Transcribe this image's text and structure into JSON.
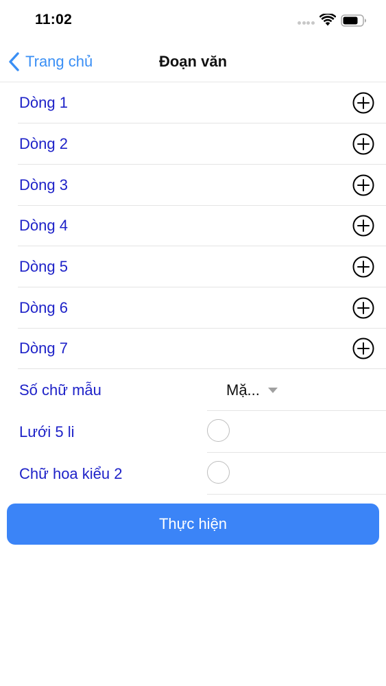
{
  "status_bar": {
    "time": "11:02"
  },
  "nav": {
    "back_label": "Trang chủ",
    "title": "Đoạn văn"
  },
  "lines": [
    {
      "label": "Dòng 1"
    },
    {
      "label": "Dòng 2"
    },
    {
      "label": "Dòng 3"
    },
    {
      "label": "Dòng 4"
    },
    {
      "label": "Dòng 5"
    },
    {
      "label": "Dòng 6"
    },
    {
      "label": "Dòng 7"
    }
  ],
  "options": {
    "sample_count": {
      "label": "Số chữ mẫu",
      "value": "Mặ..."
    },
    "grid_5li": {
      "label": "Lưới 5 li",
      "checked": false
    },
    "capital_style2": {
      "label": "Chữ hoa kiểu 2",
      "checked": false
    }
  },
  "action": {
    "label": "Thực hiện"
  },
  "colors": {
    "accent": "#3a8ff5",
    "label_blue": "#1e22c8",
    "button_bg": "#3b84f7"
  },
  "icons": {
    "back": "chevron-left-icon",
    "add": "plus-circle-icon",
    "wifi": "wifi-icon",
    "battery": "battery-icon",
    "dropdown": "caret-down-icon"
  }
}
